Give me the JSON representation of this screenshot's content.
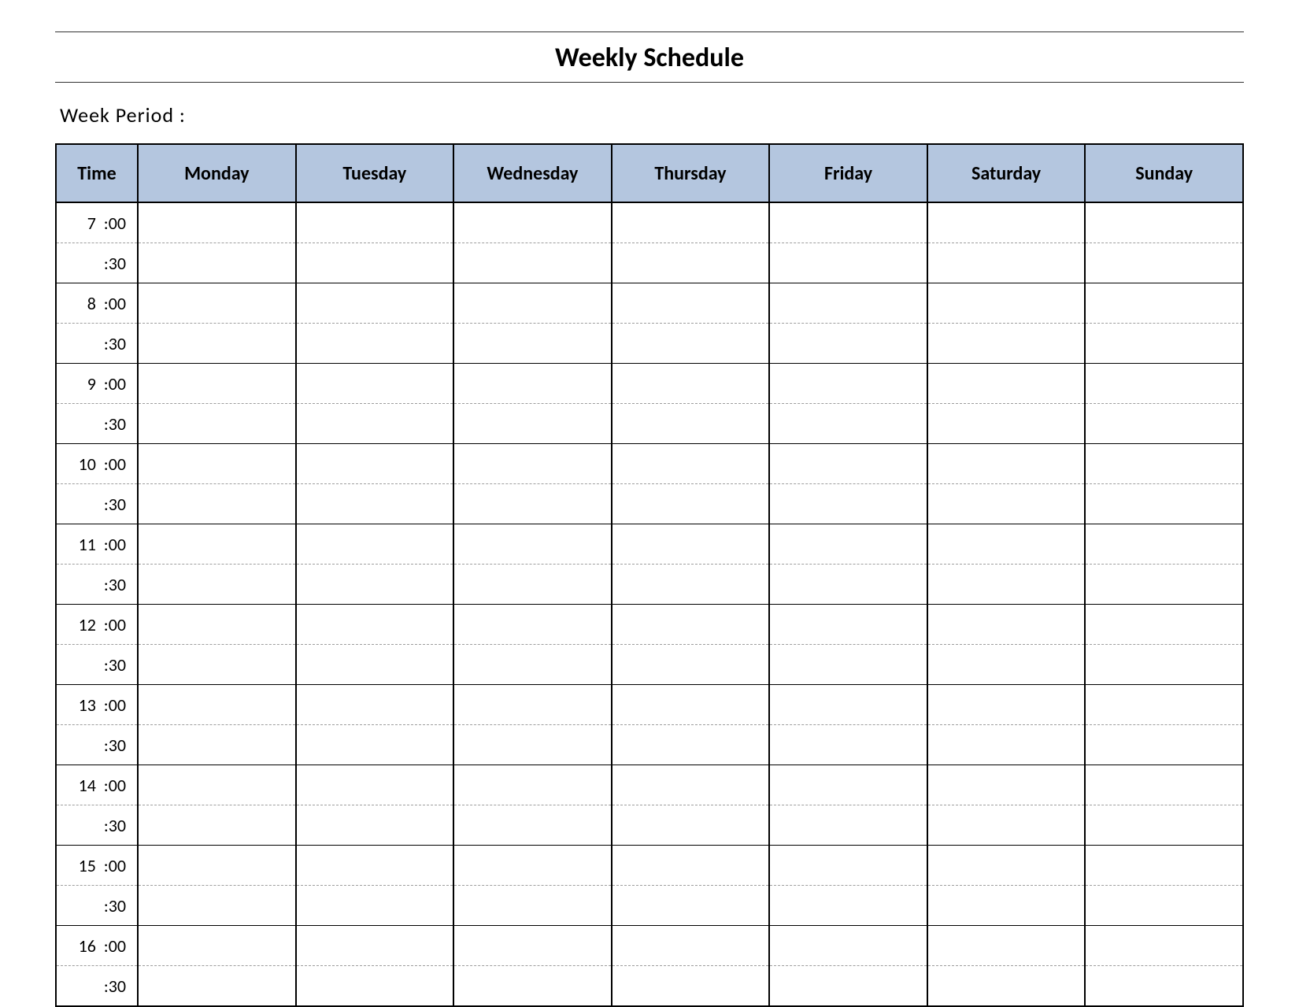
{
  "title": "Weekly Schedule",
  "week_period_label": "Week  Period  :",
  "columns": {
    "time": "Time",
    "days": [
      "Monday",
      "Tuesday",
      "Wednesday",
      "Thursday",
      "Friday",
      "Saturday",
      "Sunday"
    ]
  },
  "time_slots": [
    {
      "label": "7  :00",
      "cells": [
        "",
        "",
        "",
        "",
        "",
        "",
        ""
      ]
    },
    {
      "label": ":30",
      "cells": [
        "",
        "",
        "",
        "",
        "",
        "",
        ""
      ]
    },
    {
      "label": "8  :00",
      "cells": [
        "",
        "",
        "",
        "",
        "",
        "",
        ""
      ]
    },
    {
      "label": ":30",
      "cells": [
        "",
        "",
        "",
        "",
        "",
        "",
        ""
      ]
    },
    {
      "label": "9  :00",
      "cells": [
        "",
        "",
        "",
        "",
        "",
        "",
        ""
      ]
    },
    {
      "label": ":30",
      "cells": [
        "",
        "",
        "",
        "",
        "",
        "",
        ""
      ]
    },
    {
      "label": "10  :00",
      "cells": [
        "",
        "",
        "",
        "",
        "",
        "",
        ""
      ]
    },
    {
      "label": ":30",
      "cells": [
        "",
        "",
        "",
        "",
        "",
        "",
        ""
      ]
    },
    {
      "label": "11  :00",
      "cells": [
        "",
        "",
        "",
        "",
        "",
        "",
        ""
      ]
    },
    {
      "label": ":30",
      "cells": [
        "",
        "",
        "",
        "",
        "",
        "",
        ""
      ]
    },
    {
      "label": "12  :00",
      "cells": [
        "",
        "",
        "",
        "",
        "",
        "",
        ""
      ]
    },
    {
      "label": ":30",
      "cells": [
        "",
        "",
        "",
        "",
        "",
        "",
        ""
      ]
    },
    {
      "label": "13  :00",
      "cells": [
        "",
        "",
        "",
        "",
        "",
        "",
        ""
      ]
    },
    {
      "label": ":30",
      "cells": [
        "",
        "",
        "",
        "",
        "",
        "",
        ""
      ]
    },
    {
      "label": "14  :00",
      "cells": [
        "",
        "",
        "",
        "",
        "",
        "",
        ""
      ]
    },
    {
      "label": ":30",
      "cells": [
        "",
        "",
        "",
        "",
        "",
        "",
        ""
      ]
    },
    {
      "label": "15  :00",
      "cells": [
        "",
        "",
        "",
        "",
        "",
        "",
        ""
      ]
    },
    {
      "label": ":30",
      "cells": [
        "",
        "",
        "",
        "",
        "",
        "",
        ""
      ]
    },
    {
      "label": "16  :00",
      "cells": [
        "",
        "",
        "",
        "",
        "",
        "",
        ""
      ]
    },
    {
      "label": ":30",
      "cells": [
        "",
        "",
        "",
        "",
        "",
        "",
        ""
      ]
    }
  ]
}
